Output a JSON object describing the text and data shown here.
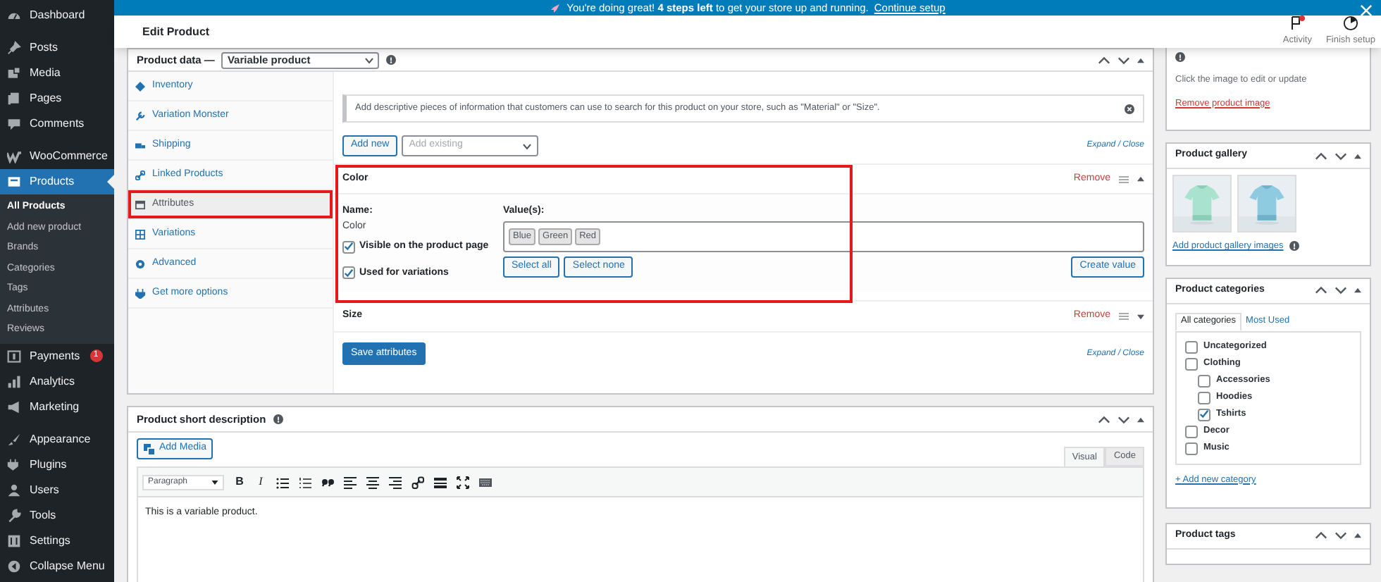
{
  "sidebar": {
    "groups": [
      {
        "items": [
          {
            "label": "Dashboard",
            "selected": false
          }
        ]
      },
      {
        "items": [
          {
            "label": "Posts",
            "selected": false
          },
          {
            "label": "Media",
            "selected": false
          },
          {
            "label": "Pages",
            "selected": false
          },
          {
            "label": "Comments",
            "selected": false
          }
        ]
      },
      {
        "items": [
          {
            "label": "WooCommerce",
            "selected": false
          },
          {
            "label": "Products",
            "selected": true,
            "children": [
              {
                "label": "All Products",
                "selected": true
              },
              {
                "label": "Add new product",
                "selected": false
              },
              {
                "label": "Brands",
                "selected": false
              },
              {
                "label": "Categories",
                "selected": false
              },
              {
                "label": "Tags",
                "selected": false
              },
              {
                "label": "Attributes",
                "selected": false
              },
              {
                "label": "Reviews",
                "selected": false
              }
            ]
          },
          {
            "label": "Payments",
            "selected": false,
            "badge": "1"
          },
          {
            "label": "Analytics",
            "selected": false
          },
          {
            "label": "Marketing",
            "selected": false
          }
        ]
      },
      {
        "items": [
          {
            "label": "Appearance",
            "selected": false
          },
          {
            "label": "Plugins",
            "selected": false
          },
          {
            "label": "Users",
            "selected": false
          },
          {
            "label": "Tools",
            "selected": false
          },
          {
            "label": "Settings",
            "selected": false
          },
          {
            "label": "Collapse Menu",
            "selected": false
          }
        ]
      }
    ]
  },
  "notice": {
    "text": "You're doing great! **4 steps left** to get your store up and running.",
    "link": "Continue setup"
  },
  "header": {
    "title": "Edit Product",
    "actions": [
      {
        "label": "Activity",
        "unread": true
      },
      {
        "label": "Finish setup",
        "unread": false
      }
    ]
  },
  "product_data": {
    "label": "Product data —",
    "type": "Variable product",
    "tabs": [
      {
        "label": "Inventory",
        "selected": false,
        "highlighted": false
      },
      {
        "label": "Variation Monster",
        "selected": false,
        "highlighted": false
      },
      {
        "label": "Shipping",
        "selected": false,
        "highlighted": false
      },
      {
        "label": "Linked Products",
        "selected": false,
        "highlighted": false
      },
      {
        "label": "Attributes",
        "selected": true,
        "highlighted": true
      },
      {
        "label": "Variations",
        "selected": false,
        "highlighted": false
      },
      {
        "label": "Advanced",
        "selected": false,
        "highlighted": false
      },
      {
        "label": "Get more options",
        "selected": false,
        "highlighted": false
      }
    ],
    "info": "Add descriptive pieces of information that customers can use to search for this product on your store, such as \"Material\" or \"Size\".",
    "add_new": "Add new",
    "add_existing_placeholder": "Add existing",
    "expand_close_top": "Expand / Close",
    "attributes": [
      {
        "name": "Color",
        "expanded": true,
        "highlighted": true,
        "remove": "Remove",
        "name_label": "Name:",
        "name_value": "Color",
        "values_label": "Value(s):",
        "values": [
          "Blue",
          "Green",
          "Red"
        ],
        "visible_label": "Visible on the product page",
        "visible": true,
        "variations_label": "Used for variations",
        "variations": true,
        "select_buttons": [
          "Select all",
          "Select none"
        ],
        "create": "Create value"
      },
      {
        "name": "Size",
        "expanded": false,
        "remove": "Remove"
      }
    ],
    "save": "Save attributes",
    "expand_close_bottom": "Expand / Close"
  },
  "short_description": {
    "title": "Product short description",
    "add_media": "Add Media",
    "tabs": [
      {
        "label": "Visual",
        "selected": true
      },
      {
        "label": "Code",
        "selected": false
      }
    ],
    "format": "Paragraph",
    "toolbar_text": [
      "B",
      "I"
    ],
    "content": "This is a variable product."
  },
  "product_image": {
    "hint": "Click the image to edit or update",
    "remove": "Remove product image"
  },
  "product_gallery": {
    "title": "Product gallery",
    "add": "Add product gallery images"
  },
  "product_categories": {
    "title": "Product categories",
    "tabs": [
      {
        "label": "All categories",
        "selected": true
      },
      {
        "label": "Most Used",
        "selected": false
      }
    ],
    "items": [
      {
        "label": "Uncategorized",
        "checked": false
      },
      {
        "label": "Clothing",
        "checked": false,
        "children": [
          {
            "label": "Accessories",
            "checked": false
          },
          {
            "label": "Hoodies",
            "checked": false
          },
          {
            "label": "Tshirts",
            "checked": true
          }
        ]
      },
      {
        "label": "Decor",
        "checked": false
      },
      {
        "label": "Music",
        "checked": false
      }
    ],
    "add": "+ Add new category"
  },
  "product_tags": {
    "title": "Product tags"
  }
}
